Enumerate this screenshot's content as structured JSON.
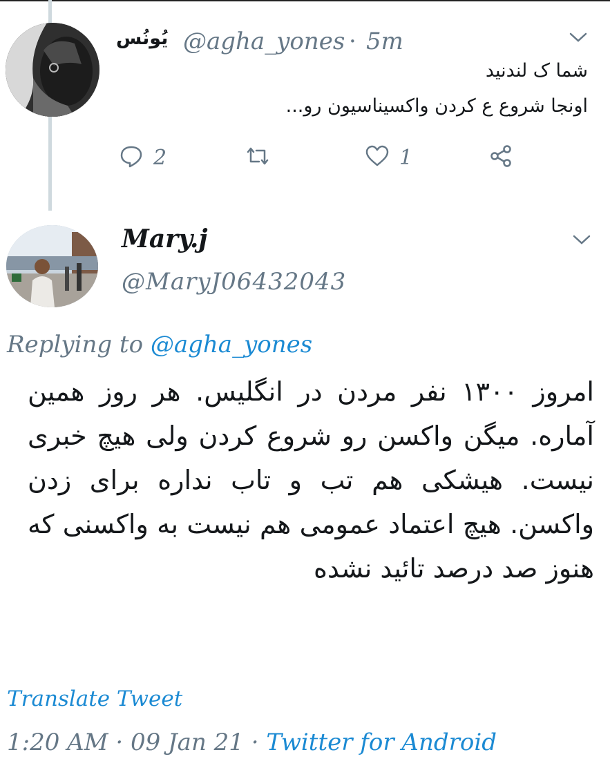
{
  "tweet1": {
    "display_name": "یُونُس",
    "handle": "@agha_yones",
    "separator": "·",
    "time": "5m",
    "text_lines": [
      "شما ک لندنید",
      "اونجا شروع ع کردن واکسیناسیون رو..."
    ],
    "reply_count": "2",
    "like_count": "1",
    "icons": [
      "reply-icon",
      "retweet-icon",
      "like-icon",
      "share-icon",
      "chevron-down-icon"
    ]
  },
  "tweet2": {
    "display_name": "Mary.j",
    "handle": "@MaryJ06432043",
    "replying_label": "Replying to",
    "replying_mention": "@agha_yones",
    "text": "امروز ۱۳۰۰ نفر مردن در انگلیس. هر روز همین آماره. میگن واکسن رو شروع کردن ولی هیچ خبری نیست. هیشکی هم تب و تاب نداره برای زدن واکسن. هیچ اعتماد عمومی هم نیست به واکسنی که هنوز صد درصد تائید نشده",
    "translate_label": "Translate Tweet",
    "time": "1:20 AM",
    "separator1": "·",
    "date": "09 Jan 21",
    "separator2": "·",
    "source": "Twitter for Android"
  },
  "colors": {
    "text": "#14171a",
    "secondary": "#657786",
    "link": "#1b8ad3",
    "thread_line": "#cfd9de"
  }
}
